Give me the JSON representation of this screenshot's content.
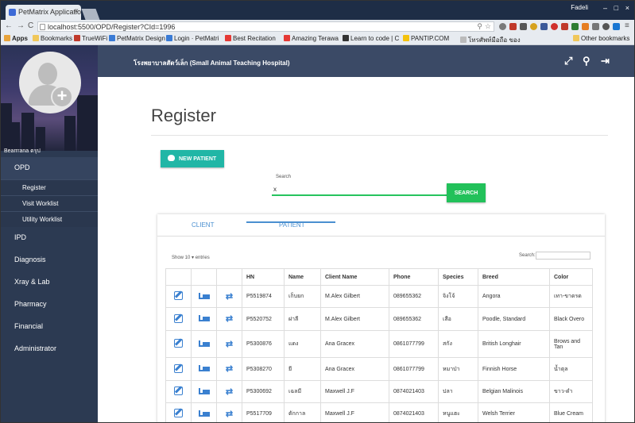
{
  "browser": {
    "tab_title": "PetMatrix Applicatio",
    "url": "localhost:5500/OPD/Register?CId=1996",
    "user": "Fadeli",
    "bookmarks": [
      "Apps",
      "Bookmarks",
      "TrueWiFi",
      "PetMatrix Design",
      "Login · PetMatri",
      "Best Recitation",
      "Amazing Terawa",
      "Learn to code | C",
      "PANTIP.COM",
      "โทรศัพท์มือถือ ของ",
      "Other bookmarks"
    ]
  },
  "sidebar": {
    "user_name": "Bearrrana ตรุป",
    "menu": {
      "opd": "OPD",
      "register": "Register",
      "visit_worklist": "Visit Worklist",
      "utility_worklist": "Utility Worklist",
      "ipd": "IPD",
      "diagnosis": "Diagnosis",
      "xray_lab": "Xray & Lab",
      "pharmacy": "Pharmacy",
      "financial": "Financial",
      "administrator": "Administrator"
    }
  },
  "header": {
    "hospital": "โรงพยาบาลสัตว์เล็ก (Small Animal Teaching Hospital)"
  },
  "page": {
    "title": "Register",
    "new_patient": "NEW PATIENT",
    "search_label": "Search",
    "search_value": "x",
    "search_button": "SEARCH"
  },
  "results": {
    "tabs": {
      "client": "CLIENT",
      "patient": "PATIENT"
    },
    "active_tab": "PATIENT",
    "show_entries": "Show 10 ▾ entries",
    "search_label": "Search:",
    "columns": {
      "hn": "HN",
      "name": "Name",
      "client": "Client Name",
      "phone": "Phone",
      "species": "Species",
      "breed": "Breed",
      "color": "Color"
    },
    "rows": [
      {
        "hn": "P5519874",
        "name": "เก็บยก",
        "client": "M.Alex Gilbert",
        "phone": "089655362",
        "species": "จิงโจ้",
        "breed": "Angora",
        "color": "เทา-ขาดรด"
      },
      {
        "hn": "P5520752",
        "name": "ฝาลี",
        "client": "M.Alex Gilbert",
        "phone": "089655362",
        "species": "เสือ",
        "breed": "Poodle, Standard",
        "color": "Black Overo"
      },
      {
        "hn": "P5300876",
        "name": "แดง",
        "client": "Ana Gracex",
        "phone": "0861077799",
        "species": "สกัง",
        "breed": "British Longhair",
        "color": "Brows and Tan"
      },
      {
        "hn": "P5308270",
        "name": "ยี",
        "client": "Ana Gracex",
        "phone": "0861077799",
        "species": "หมาป่า",
        "breed": "Finnish Horse",
        "color": "น้ำตุล"
      },
      {
        "hn": "P5300692",
        "name": "เฉลมี",
        "client": "Maxwell J.F",
        "phone": "0874021403",
        "species": "ปลา",
        "breed": "Belgian Malinois",
        "color": "ขาว-ดำ"
      },
      {
        "hn": "P5517709",
        "name": "ตักกาล",
        "client": "Maxwell J.F",
        "phone": "0874021403",
        "species": "หนูแฮะ",
        "breed": "Welsh Terrier",
        "color": "Blue Cream"
      }
    ]
  }
}
